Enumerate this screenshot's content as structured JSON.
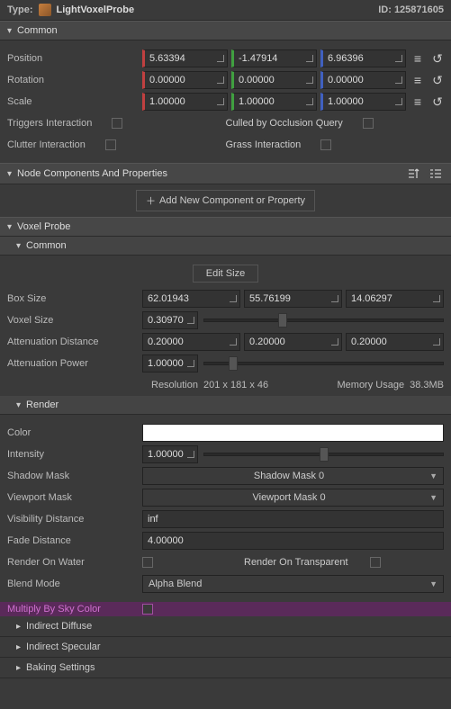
{
  "type": {
    "label": "Type:",
    "name": "LightVoxelProbe",
    "id_label": "ID: 125871605"
  },
  "common": {
    "title": "Common",
    "position_label": "Position",
    "position": {
      "x": "5.63394",
      "y": "-1.47914",
      "z": "6.96396"
    },
    "rotation_label": "Rotation",
    "rotation": {
      "x": "0.00000",
      "y": "0.00000",
      "z": "0.00000"
    },
    "scale_label": "Scale",
    "scale": {
      "x": "1.00000",
      "y": "1.00000",
      "z": "1.00000"
    },
    "triggers_label": "Triggers Interaction",
    "clutter_label": "Clutter Interaction",
    "culled_label": "Culled by Occlusion Query",
    "grass_label": "Grass Interaction"
  },
  "node_comp": {
    "title": "Node Components And Properties",
    "add_label": "Add New Component or Property"
  },
  "voxel": {
    "title": "Voxel Probe",
    "common_title": "Common",
    "edit_size": "Edit Size",
    "box_size_label": "Box Size",
    "box_size": {
      "x": "62.01943",
      "y": "55.76199",
      "z": "14.06297"
    },
    "voxel_size_label": "Voxel Size",
    "voxel_size": "0.30970",
    "atten_dist_label": "Attenuation Distance",
    "atten_dist": {
      "x": "0.20000",
      "y": "0.20000",
      "z": "0.20000"
    },
    "atten_power_label": "Attenuation Power",
    "atten_power": "1.00000",
    "resolution_label": "Resolution",
    "resolution_value": "201  x  181  x  46",
    "memory_label": "Memory Usage",
    "memory_value": "38.3MB"
  },
  "render": {
    "title": "Render",
    "color_label": "Color",
    "intensity_label": "Intensity",
    "intensity": "1.00000",
    "shadow_mask_label": "Shadow Mask",
    "shadow_mask_value": "Shadow Mask 0",
    "viewport_mask_label": "Viewport Mask",
    "viewport_mask_value": "Viewport Mask 0",
    "visibility_label": "Visibility Distance",
    "visibility_value": "inf",
    "fade_label": "Fade Distance",
    "fade_value": "4.00000",
    "render_water_label": "Render On Water",
    "render_trans_label": "Render On Transparent",
    "blend_mode_label": "Blend Mode",
    "blend_mode_value": "Alpha Blend",
    "multiply_sky_label": "Multiply By Sky Color"
  },
  "sections": {
    "indirect_diffuse": "Indirect Diffuse",
    "indirect_specular": "Indirect Specular",
    "baking_settings": "Baking Settings"
  }
}
